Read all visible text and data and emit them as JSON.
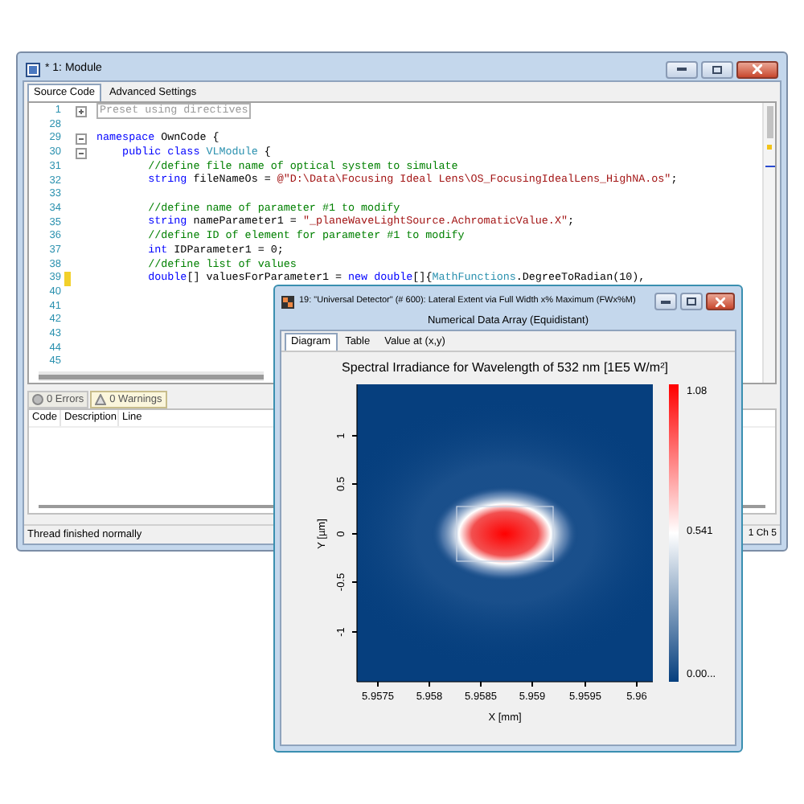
{
  "module_window": {
    "title": "* 1: Module",
    "tabs": [
      {
        "label": "Source Code",
        "selected": true
      },
      {
        "label": "Advanced Settings",
        "selected": false
      }
    ],
    "code_lines": [
      {
        "number": "1",
        "expanded": false,
        "changed": false,
        "tokens": [
          {
            "kind": "region",
            "text": "Preset using directives"
          }
        ]
      },
      {
        "number": "28",
        "changed": false
      },
      {
        "number": "29",
        "expanded": true,
        "changed": false,
        "tokens": [
          {
            "kind": "kw",
            "text": "namespace"
          },
          {
            "kind": "plain",
            "text": " OwnCode {"
          }
        ]
      },
      {
        "number": "30",
        "expanded": true,
        "changed": false,
        "tokens": [
          {
            "kind": "kw",
            "text": "    public class "
          },
          {
            "kind": "type",
            "text": "VLModule"
          },
          {
            "kind": "plain",
            "text": " {"
          }
        ]
      },
      {
        "number": "31",
        "changed": false,
        "tokens": [
          {
            "kind": "comment",
            "text": "        //define file name of optical system to simulate"
          }
        ]
      },
      {
        "number": "32",
        "changed": false,
        "tokens": [
          {
            "kind": "kw",
            "text": "        string"
          },
          {
            "kind": "plain",
            "text": " fileNameOs = "
          },
          {
            "kind": "str",
            "text": "@\"D:\\Data\\Focusing Ideal Lens\\OS_FocusingIdealLens_HighNA.os\""
          },
          {
            "kind": "plain",
            "text": ";"
          }
        ]
      },
      {
        "number": "33",
        "changed": false
      },
      {
        "number": "34",
        "changed": false,
        "tokens": [
          {
            "kind": "comment",
            "text": "        //define name of parameter #1 to modify"
          }
        ]
      },
      {
        "number": "35",
        "changed": false,
        "tokens": [
          {
            "kind": "kw",
            "text": "        string"
          },
          {
            "kind": "plain",
            "text": " nameParameter1 = "
          },
          {
            "kind": "str",
            "text": "\"_planeWaveLightSource.AchromaticValue.X\""
          },
          {
            "kind": "plain",
            "text": ";"
          }
        ]
      },
      {
        "number": "36",
        "changed": false,
        "tokens": [
          {
            "kind": "comment",
            "text": "        //define ID of element for parameter #1 to modify"
          }
        ]
      },
      {
        "number": "37",
        "changed": false,
        "tokens": [
          {
            "kind": "kw",
            "text": "        int"
          },
          {
            "kind": "plain",
            "text": " IDParameter1 = 0;"
          }
        ]
      },
      {
        "number": "38",
        "changed": false,
        "tokens": [
          {
            "kind": "comment",
            "text": "        //define list of values"
          }
        ]
      },
      {
        "number": "39",
        "changed": true,
        "tokens": [
          {
            "kind": "kw",
            "text": "        double"
          },
          {
            "kind": "plain",
            "text": "[] valuesForParameter1 = "
          },
          {
            "kind": "kw",
            "text": "new double"
          },
          {
            "kind": "plain",
            "text": "[]{"
          },
          {
            "kind": "type",
            "text": "MathFunctions"
          },
          {
            "kind": "plain",
            "text": ".DegreeToRadian(10),"
          }
        ]
      },
      {
        "number": "40",
        "changed": false
      },
      {
        "number": "41",
        "changed": false
      },
      {
        "number": "42",
        "changed": false
      },
      {
        "number": "43",
        "changed": false
      },
      {
        "number": "44",
        "changed": false
      },
      {
        "number": "45",
        "changed": false
      }
    ],
    "message_tabs": [
      {
        "kind": "errors",
        "label": "0 Errors",
        "selected": false
      },
      {
        "kind": "warnings",
        "label": "0 Warnings",
        "selected": true
      }
    ],
    "message_table": {
      "columns": [
        "Code",
        "Description",
        "Line"
      ]
    },
    "status_bar": {
      "message": "Thread finished normally",
      "position": "1 Ch 5"
    }
  },
  "detector_window": {
    "title": "19: \"Universal Detector\" (# 600): Lateral Extent via Full Width x% Maximum (FWx%M)",
    "subtitle": "Numerical Data Array (Equidistant)",
    "tabs": [
      {
        "label": "Diagram",
        "selected": true
      },
      {
        "label": "Table",
        "selected": false
      },
      {
        "label": "Value at (x,y)",
        "selected": false
      }
    ],
    "plot": {
      "title": "Spectral Irradiance for Wavelength of 532 nm  [1E5 W/m²]",
      "xlabel": "X [mm]",
      "ylabel": "Y [µm]",
      "xticks": [
        "5.9575",
        "5.958",
        "5.9585",
        "5.959",
        "5.9595",
        "5.96"
      ],
      "yticks": [
        "1",
        "0.5",
        "0",
        "-0.5",
        "-1"
      ],
      "colorbar_labels": [
        "1.08",
        "0.541",
        "0.00..."
      ]
    }
  }
}
